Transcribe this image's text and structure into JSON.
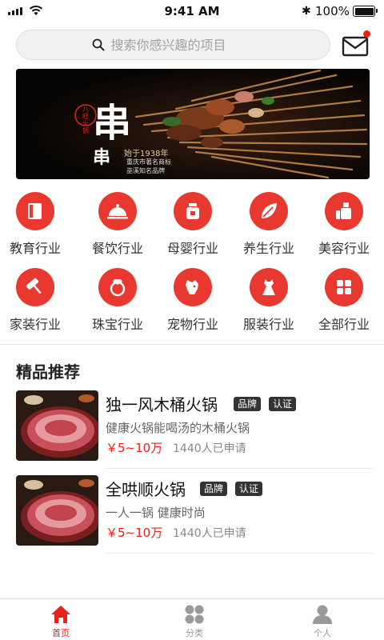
{
  "status_bar": {
    "time": "9:41 AM",
    "battery": "100%"
  },
  "search": {
    "placeholder": "搜索你感兴趣的项目"
  },
  "banner": {
    "big_char": "串",
    "small_char": "串",
    "seal_text": "八旺火锅",
    "tagline": "始于1938年",
    "sub1": "重庆市著名商标",
    "sub2": "巫溪知名品牌"
  },
  "categories": [
    {
      "label": "教育行业",
      "icon": "book-icon"
    },
    {
      "label": "餐饮行业",
      "icon": "cloche-icon"
    },
    {
      "label": "母婴行业",
      "icon": "baby-jar-icon"
    },
    {
      "label": "养生行业",
      "icon": "leaf-icon"
    },
    {
      "label": "美容行业",
      "icon": "cosmetics-icon"
    },
    {
      "label": "家装行业",
      "icon": "paint-roller-icon"
    },
    {
      "label": "珠宝行业",
      "icon": "ring-icon"
    },
    {
      "label": "宠物行业",
      "icon": "dog-icon"
    },
    {
      "label": "服装行业",
      "icon": "dress-icon"
    },
    {
      "label": "全部行业",
      "icon": "grid-icon"
    }
  ],
  "section": {
    "title": "精品推荐"
  },
  "products": [
    {
      "title": "独一风木桶火锅",
      "tags": [
        "品牌",
        "认证"
      ],
      "desc": "健康火锅能喝汤的木桶火锅",
      "price": "￥5~10万",
      "applied": "1440人已申请"
    },
    {
      "title": "全哄顺火锅",
      "tags": [
        "品牌",
        "认证"
      ],
      "desc": "一人一锅 健康时尚",
      "price": "￥5~10万",
      "applied": "1440人已申请"
    }
  ],
  "tabbar": {
    "items": [
      {
        "label": "首页",
        "icon": "home-icon",
        "active": true
      },
      {
        "label": "分类",
        "icon": "category-icon",
        "active": false
      },
      {
        "label": "个人",
        "icon": "person-icon",
        "active": false
      }
    ],
    "active_color": "#e8231e",
    "inactive_color": "#999999"
  },
  "colors": {
    "accent": "#e9382f",
    "price": "#e8231e"
  }
}
